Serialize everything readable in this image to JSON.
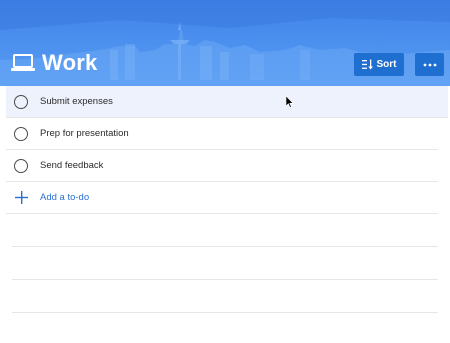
{
  "list": {
    "title": "Work",
    "icon": "laptop-icon"
  },
  "toolbar": {
    "sort_label": "Sort",
    "sort_icon": "sort-icon",
    "more_icon": "more-options-icon"
  },
  "tasks": [
    {
      "label": "Submit expenses",
      "completed": false,
      "selected": true
    },
    {
      "label": "Prep for presentation",
      "completed": false,
      "selected": false
    },
    {
      "label": "Send feedback",
      "completed": false,
      "selected": false
    }
  ],
  "add_task": {
    "label": "Add a to-do",
    "icon": "plus-icon"
  },
  "colors": {
    "header": "#4a8fee",
    "button": "#1f6fd1",
    "accent_text": "#2b6fd6",
    "selected_row": "#eef2fc"
  }
}
